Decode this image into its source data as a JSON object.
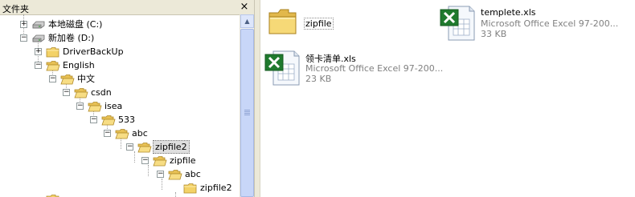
{
  "folders_pane": {
    "title": "文件夹",
    "close_glyph": "×"
  },
  "tree": {
    "local_disk_c": {
      "label": "本地磁盘 (C:)",
      "expander": "+"
    },
    "new_volume_d": {
      "label": "新加卷 (D:)",
      "expander": "−"
    },
    "driverbackup": {
      "label": "DriverBackUp",
      "expander": "+"
    },
    "english": {
      "label": "English",
      "expander": "−"
    },
    "zhongwen": {
      "label": "中文",
      "expander": "−"
    },
    "csdn": {
      "label": "csdn",
      "expander": "−"
    },
    "isea": {
      "label": "isea",
      "expander": "−"
    },
    "f533": {
      "label": "533",
      "expander": "−"
    },
    "abc": {
      "label": "abc",
      "expander": "−"
    },
    "zipfile2": {
      "label": "zipfile2",
      "expander": "−",
      "selected": true
    },
    "zipfile": {
      "label": "zipfile",
      "expander": "−"
    },
    "abc_inner": {
      "label": "abc",
      "expander": "−"
    },
    "zipfile2_inner": {
      "label": "zipfile2"
    }
  },
  "files": [
    {
      "name": "zipfile",
      "kind": "folder-icon"
    },
    {
      "name": "templete.xls",
      "type": "Microsoft Office Excel 97-200...",
      "size": "33 KB",
      "kind": "excel-file-icon"
    },
    {
      "name": "领卡清单.xls",
      "type": "Microsoft Office Excel 97-200...",
      "size": "23 KB",
      "kind": "excel-file-icon"
    }
  ],
  "colors": {
    "pane_header": "#ece9d8",
    "folder_yellow": "#f3d267",
    "excel_green": "#1f7a2e",
    "secondary_text": "#808080"
  }
}
